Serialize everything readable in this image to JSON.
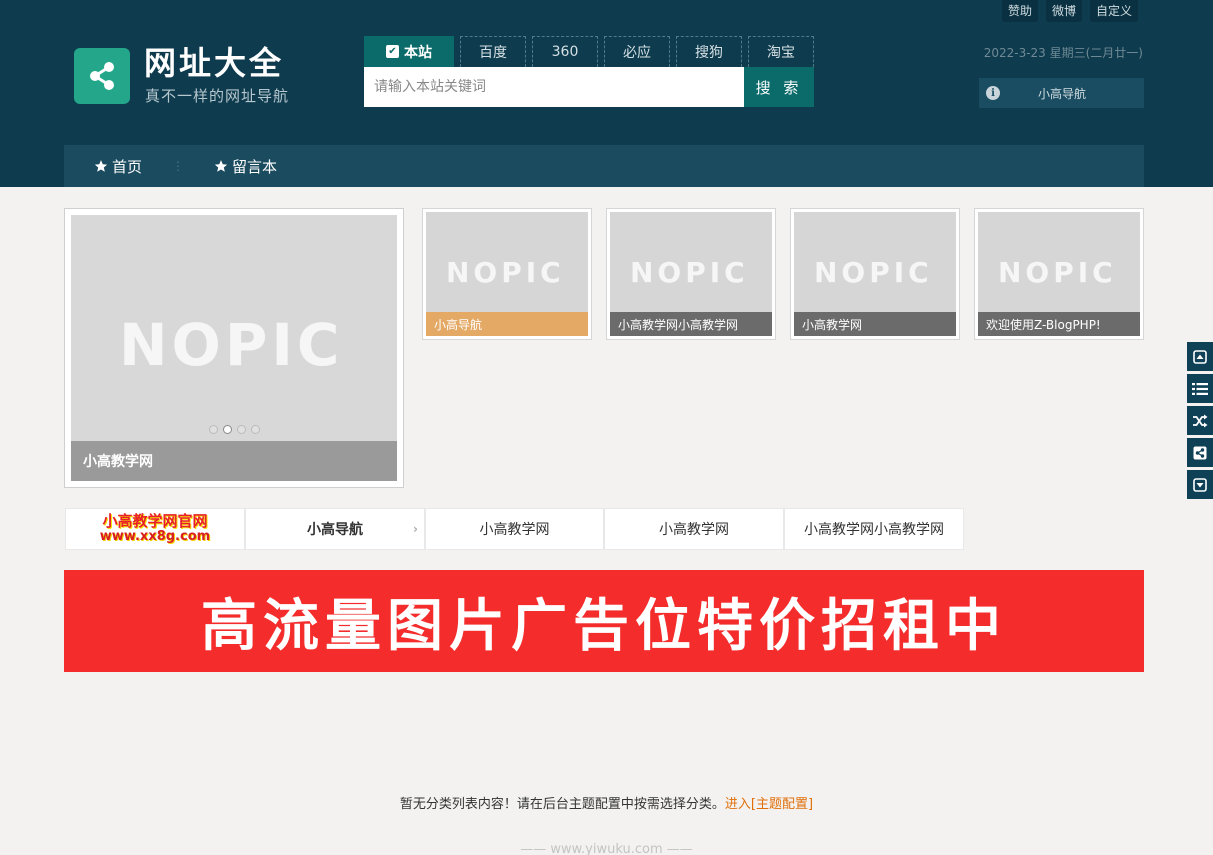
{
  "top_links": [
    "赞助",
    "微博",
    "自定义"
  ],
  "brand": {
    "title": "网址大全",
    "subtitle": "真不一样的网址导航"
  },
  "search": {
    "tabs": [
      "本站",
      "百度",
      "360",
      "必应",
      "搜狗",
      "淘宝"
    ],
    "active_tab": "本站",
    "placeholder": "请输入本站关键词",
    "button": "搜 索"
  },
  "date": "2022-3-23 星期三(二月廿一)",
  "info": {
    "icon": "info-icon",
    "text": "小高导航"
  },
  "nav": [
    {
      "label": "首页",
      "icon": "star-icon"
    },
    {
      "label": "留言本",
      "icon": "star-icon"
    }
  ],
  "slider": {
    "placeholder": "NOPIC",
    "caption": "小高教学网",
    "dots": 4,
    "active_dot": 2
  },
  "cards": [
    {
      "placeholder": "NOPIC",
      "caption": "小高导航"
    },
    {
      "placeholder": "NOPIC",
      "caption": "小高教学网小高教学网"
    },
    {
      "placeholder": "NOPIC",
      "caption": "小高教学网"
    },
    {
      "placeholder": "NOPIC",
      "caption": "欢迎使用Z-BlogPHP!"
    }
  ],
  "links": {
    "logo_title": "小高教学网官网",
    "logo_url": "www.xx8g.com",
    "items": [
      "小高导航",
      "小高教学网",
      "小高教学网",
      "小高教学网小高教学网"
    ],
    "arrow": "›"
  },
  "ad_banner": "高流量图片广告位特价招租中",
  "notice": {
    "text": "暂无分类列表内容！请在后台主题配置中按需选择分类。",
    "link": "进入[主题配置]"
  },
  "footer": "—— www.yiwuku.com ——",
  "side_tools": [
    "top-icon",
    "list-icon",
    "random-icon",
    "share-icon",
    "bottom-icon"
  ],
  "colors": {
    "header_bg": "#0e3b4e",
    "accent": "#0b6a6a",
    "logo_green": "#23a68a",
    "ad_red": "#f42c2c",
    "link_orange": "#e0700b"
  }
}
